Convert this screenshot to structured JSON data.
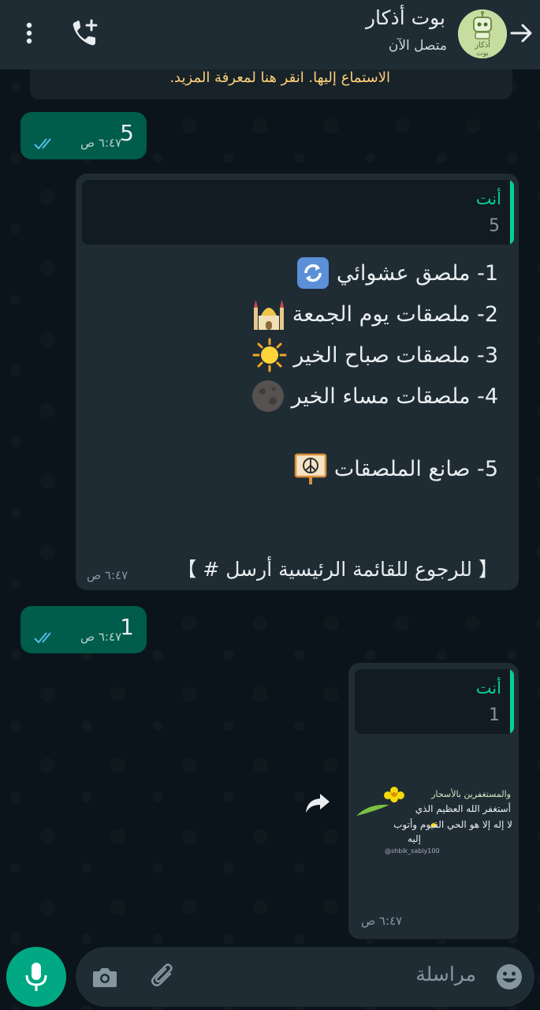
{
  "header": {
    "contact_name": "بوت أذكار",
    "status": "متصل الآن",
    "avatar_text": "أذكار بوت"
  },
  "notice": {
    "text": "الاستماع إليها. انقر هنا لمعرفة المزيد."
  },
  "messages": [
    {
      "type": "outgoing",
      "text": "5",
      "time": "٦:٤٧ ص",
      "read": true
    },
    {
      "type": "incoming",
      "quote": {
        "name": "أنت",
        "text": "5"
      },
      "lines": [
        {
          "text": "1- ملصق عشوائي",
          "icon": "refresh-emoji"
        },
        {
          "text": "2- ملصقات يوم الجمعة",
          "icon": "mosque-emoji"
        },
        {
          "text": "3- ملصقات صباح الخير",
          "icon": "sun-emoji"
        },
        {
          "text": "4- ملصقات مساء الخير",
          "icon": "moon-emoji"
        },
        {
          "text": "5- صانع الملصقات",
          "icon": "peace-sign-emoji"
        }
      ],
      "footer": "【 للرجوع للقائمة الرئيسية أرسل  #  】",
      "time": "٦:٤٧ ص"
    },
    {
      "type": "outgoing",
      "text": "1",
      "time": "٦:٤٧ ص",
      "read": true
    },
    {
      "type": "incoming",
      "quote": {
        "name": "أنت",
        "text": "1"
      },
      "sticker_lines": [
        "والمستغفرين بالأسحار",
        "أستغفر الله العظيم الذي",
        "لا إله إلا هو الحي القيوم وأتوب",
        "إليه"
      ],
      "sticker_handle": "@shbik_sabiy100",
      "time": "٦:٤٧ ص"
    }
  ],
  "input": {
    "placeholder": "مراسلة"
  },
  "colors": {
    "header_bg": "#1f2c34",
    "chat_bg": "#0b141a",
    "outgoing_bubble": "#005c4b",
    "incoming_bubble": "#1f2c34",
    "accent": "#00a884",
    "quote_name": "#06cf9c",
    "read_ticks": "#53bdeb",
    "notice_text": "#ffd279"
  }
}
